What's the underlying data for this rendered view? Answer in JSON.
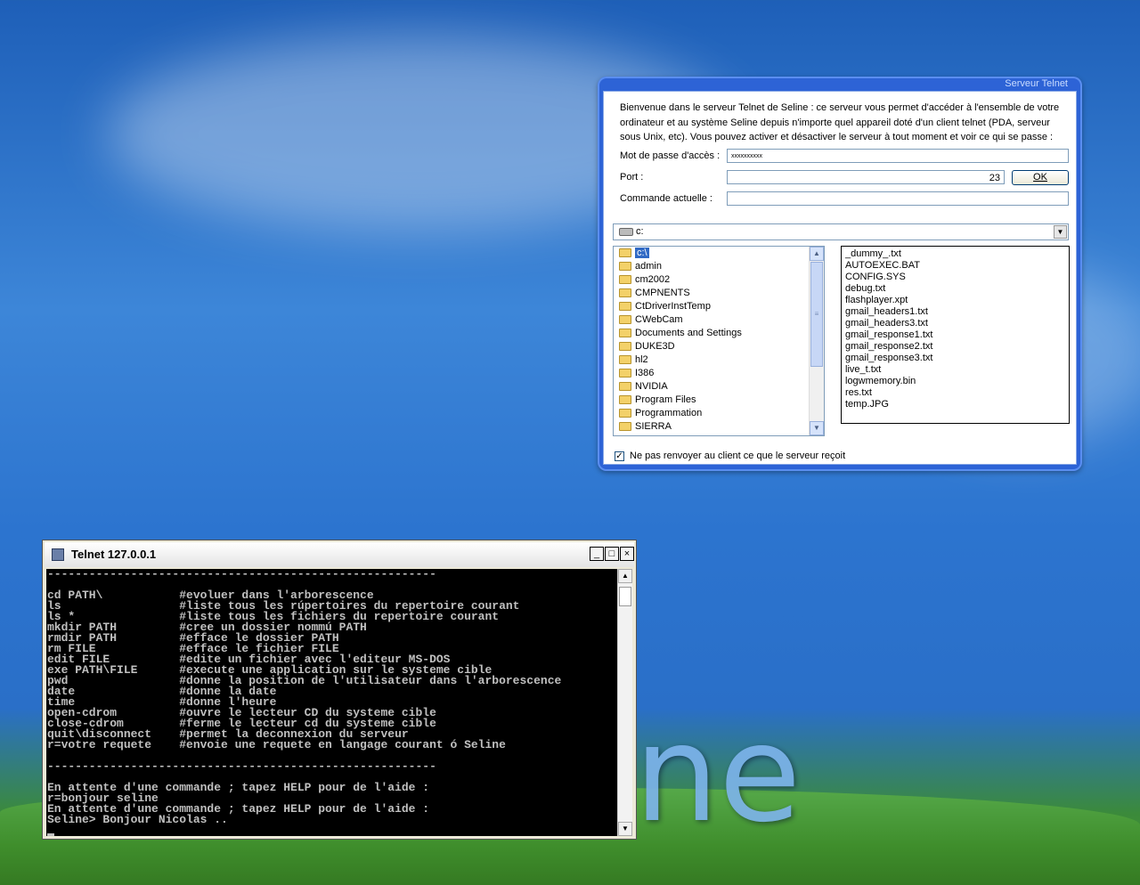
{
  "server_panel": {
    "title": "Serveur Telnet",
    "description": "Bienvenue dans le serveur Telnet de Seline : ce serveur vous permet d'accéder à l'ensemble de votre ordinateur et au système Seline depuis n'importe quel appareil doté d'un client telnet (PDA, serveur sous Unix, etc). Vous pouvez activer et désactiver le serveur à tout moment et voir ce qui se passe :",
    "password_label": "Mot de passe d'accès :",
    "password_value": "xxxxxxxxxx",
    "port_label": "Port :",
    "port_value": "23",
    "ok_label": "OK",
    "current_command_label": "Commande actuelle :",
    "current_command_value": "",
    "drive": "c:",
    "directories": [
      "c:\\",
      "admin",
      "cm2002",
      "CMPNENTS",
      "CtDriverInstTemp",
      "CWebCam",
      "Documents and Settings",
      "DUKE3D",
      "hl2",
      "I386",
      "NVIDIA",
      "Program Files",
      "Programmation",
      "SIERRA"
    ],
    "files": [
      "_dummy_.txt",
      "AUTOEXEC.BAT",
      "CONFIG.SYS",
      "debug.txt",
      "flashplayer.xpt",
      "gmail_headers1.txt",
      "gmail_headers3.txt",
      "gmail_response1.txt",
      "gmail_response2.txt",
      "gmail_response3.txt",
      "live_t.txt",
      "logwmemory.bin",
      "res.txt",
      "temp.JPG"
    ],
    "checkbox_checked": true,
    "checkbox_label": "Ne pas renvoyer au client ce que  le serveur reçoit"
  },
  "console_window": {
    "title": "Telnet 127.0.0.1",
    "minimize_label": "_",
    "maximize_label": "□",
    "close_label": "×",
    "lines": [
      "--------------------------------------------------------",
      "",
      "cd PATH\\           #evoluer dans l'arborescence",
      "ls                 #liste tous les rúpertoires du repertoire courant",
      "ls *               #liste tous les fichiers du repertoire courant",
      "mkdir PATH         #cree un dossier nommú PATH",
      "rmdir PATH         #efface le dossier PATH",
      "rm FILE            #efface le fichier FILE",
      "edit FILE          #edite un fichier avec l'editeur MS-DOS",
      "exe PATH\\FILE      #execute une application sur le systeme cible",
      "pwd                #donne la position de l'utilisateur dans l'arborescence",
      "date               #donne la date",
      "time               #donne l'heure",
      "open-cdrom         #ouvre le lecteur CD du systeme cible",
      "close-cdrom        #ferme le lecteur cd du systeme cible",
      "quit\\disconnect    #permet la deconnexion du serveur",
      "r=votre requete    #envoie une requete en langage courant ó Seline",
      "",
      "--------------------------------------------------------",
      "",
      "En attente d'une commande ; tapez HELP pour de l'aide :",
      "r=bonjour seline",
      "En attente d'une commande ; tapez HELP pour de l'aide :",
      "Seline> Bonjour Nicolas .."
    ]
  },
  "desktop": {
    "logo_text": "ne"
  }
}
